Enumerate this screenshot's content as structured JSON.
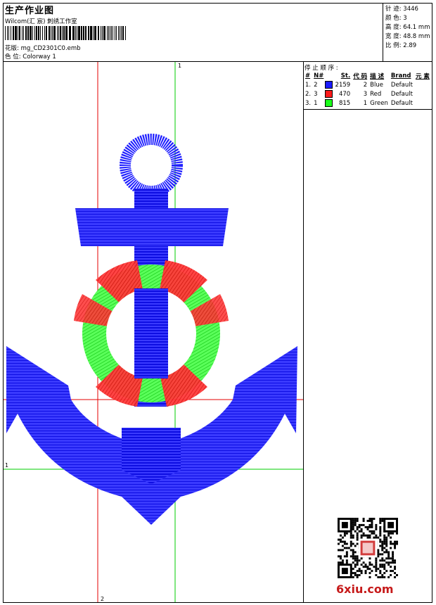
{
  "header": {
    "title": "生产作业图",
    "software": "Wilcom(汇 宸) 刺绣工作室",
    "design_file_label": "花版:",
    "design_file": "mg_CD2301C0.emb",
    "colorway_label": "色 位:",
    "colorway": "Colorway 1"
  },
  "stats": {
    "stitches_label": "针 迹:",
    "stitches": "3446",
    "colors_label": "颜 色:",
    "colors": "3",
    "height_label": "高 度:",
    "height": "64.1 mm",
    "width_label": "宽 度:",
    "width": "48.8 mm",
    "scale_label": "比 例:",
    "scale": "2.89"
  },
  "stop_sequence": {
    "title": "停 止 顺 序 :",
    "headers": [
      "#",
      "N#",
      "St.",
      "代 码",
      "描 述",
      "Brand",
      "元 素"
    ],
    "rows": [
      {
        "idx": "1.",
        "n": "2",
        "color": "#1a1aff",
        "st": "2159",
        "code": "2",
        "desc": "Blue",
        "brand": "Default"
      },
      {
        "idx": "2.",
        "n": "3",
        "color": "#ff1a1a",
        "st": "470",
        "code": "3",
        "desc": "Red",
        "brand": "Default"
      },
      {
        "idx": "3.",
        "n": "1",
        "color": "#1aff1a",
        "st": "815",
        "code": "1",
        "desc": "Green",
        "brand": "Default"
      }
    ]
  },
  "guides": {
    "green_vertical_label": "1",
    "green_horizontal_label": "1",
    "red_vertical_label": "2"
  },
  "colors": {
    "blue": "#1a1aff",
    "red": "#ff1a1a",
    "green": "#1aff1a",
    "guide_red": "#e60000",
    "guide_green": "#00cc00"
  },
  "watermark": "6xiu.com"
}
